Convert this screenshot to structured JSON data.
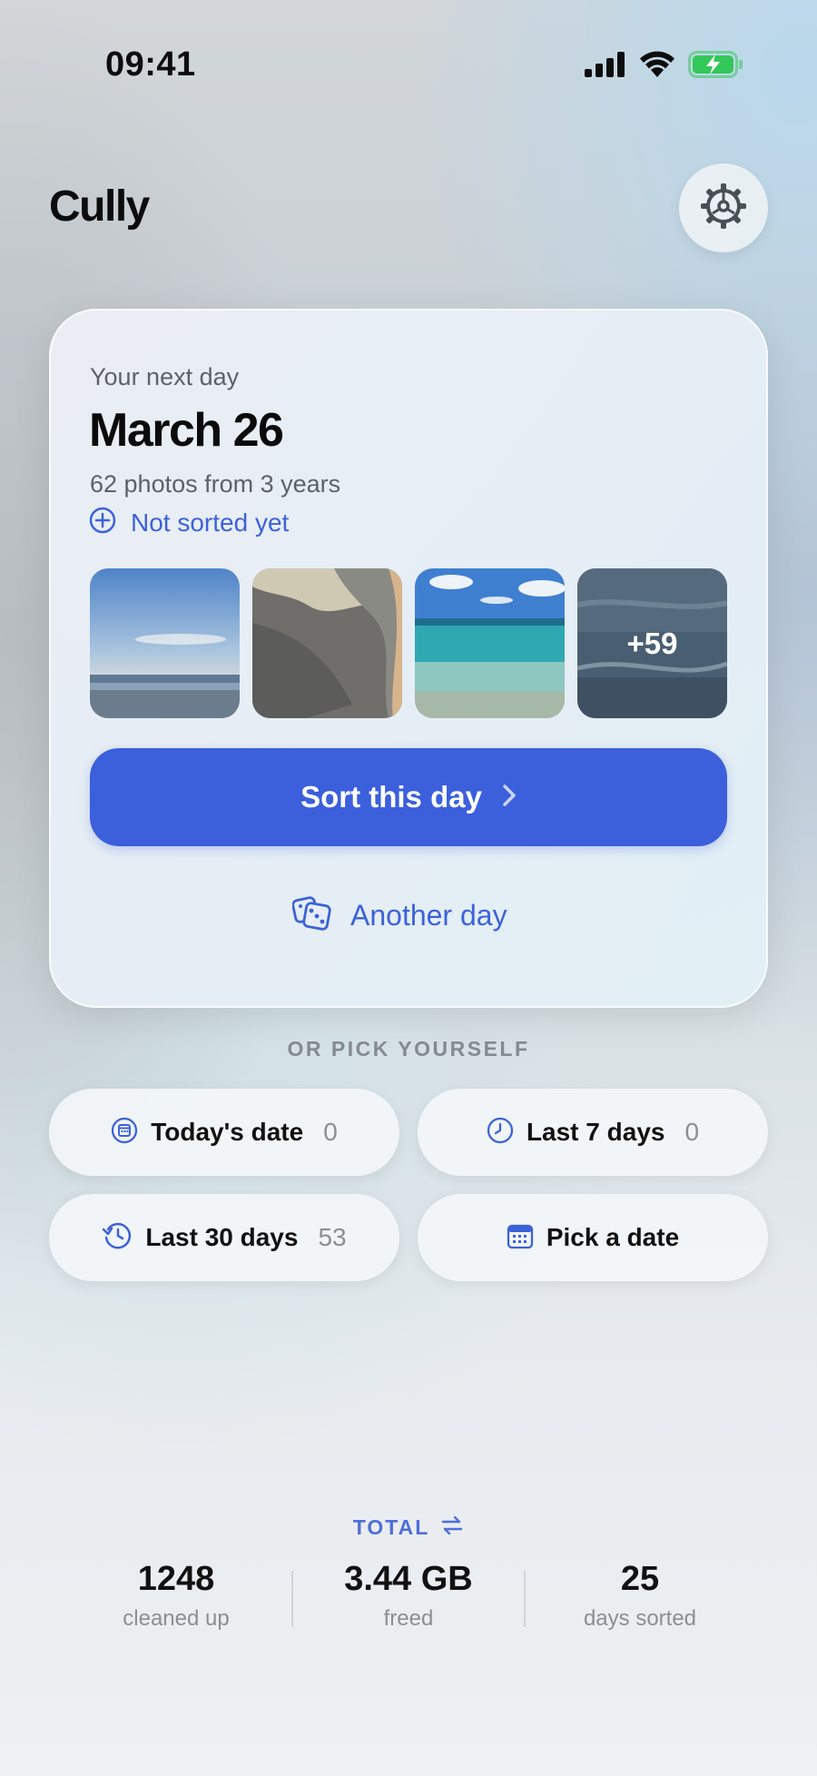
{
  "status_bar": {
    "time": "09:41",
    "battery_color": "#34c759"
  },
  "header": {
    "app_title": "Cully",
    "settings_icon": "gear-icon"
  },
  "day_card": {
    "eyebrow": "Your next day",
    "date": "March 26",
    "subtitle": "62 photos from 3 years",
    "status": "Not sorted yet",
    "more_count": "+59",
    "sort_button": "Sort this day",
    "another_button": "Another day"
  },
  "pick": {
    "section_label": "OR PICK YOURSELF",
    "options": [
      {
        "label": "Today's date",
        "count": "0",
        "icon": "calendar-icon"
      },
      {
        "label": "Last 7 days",
        "count": "0",
        "icon": "clock-icon"
      },
      {
        "label": "Last 30 days",
        "count": "53",
        "icon": "history-icon"
      },
      {
        "label": "Pick a date",
        "count": "",
        "icon": "calendar-grid-icon"
      }
    ]
  },
  "totals": {
    "label": "TOTAL",
    "stats": [
      {
        "value": "1248",
        "caption": "cleaned up"
      },
      {
        "value": "3.44 GB",
        "caption": "freed"
      },
      {
        "value": "25",
        "caption": "days sorted"
      }
    ]
  },
  "colors": {
    "accent": "#3c5fdc",
    "link": "#3d62d8"
  }
}
